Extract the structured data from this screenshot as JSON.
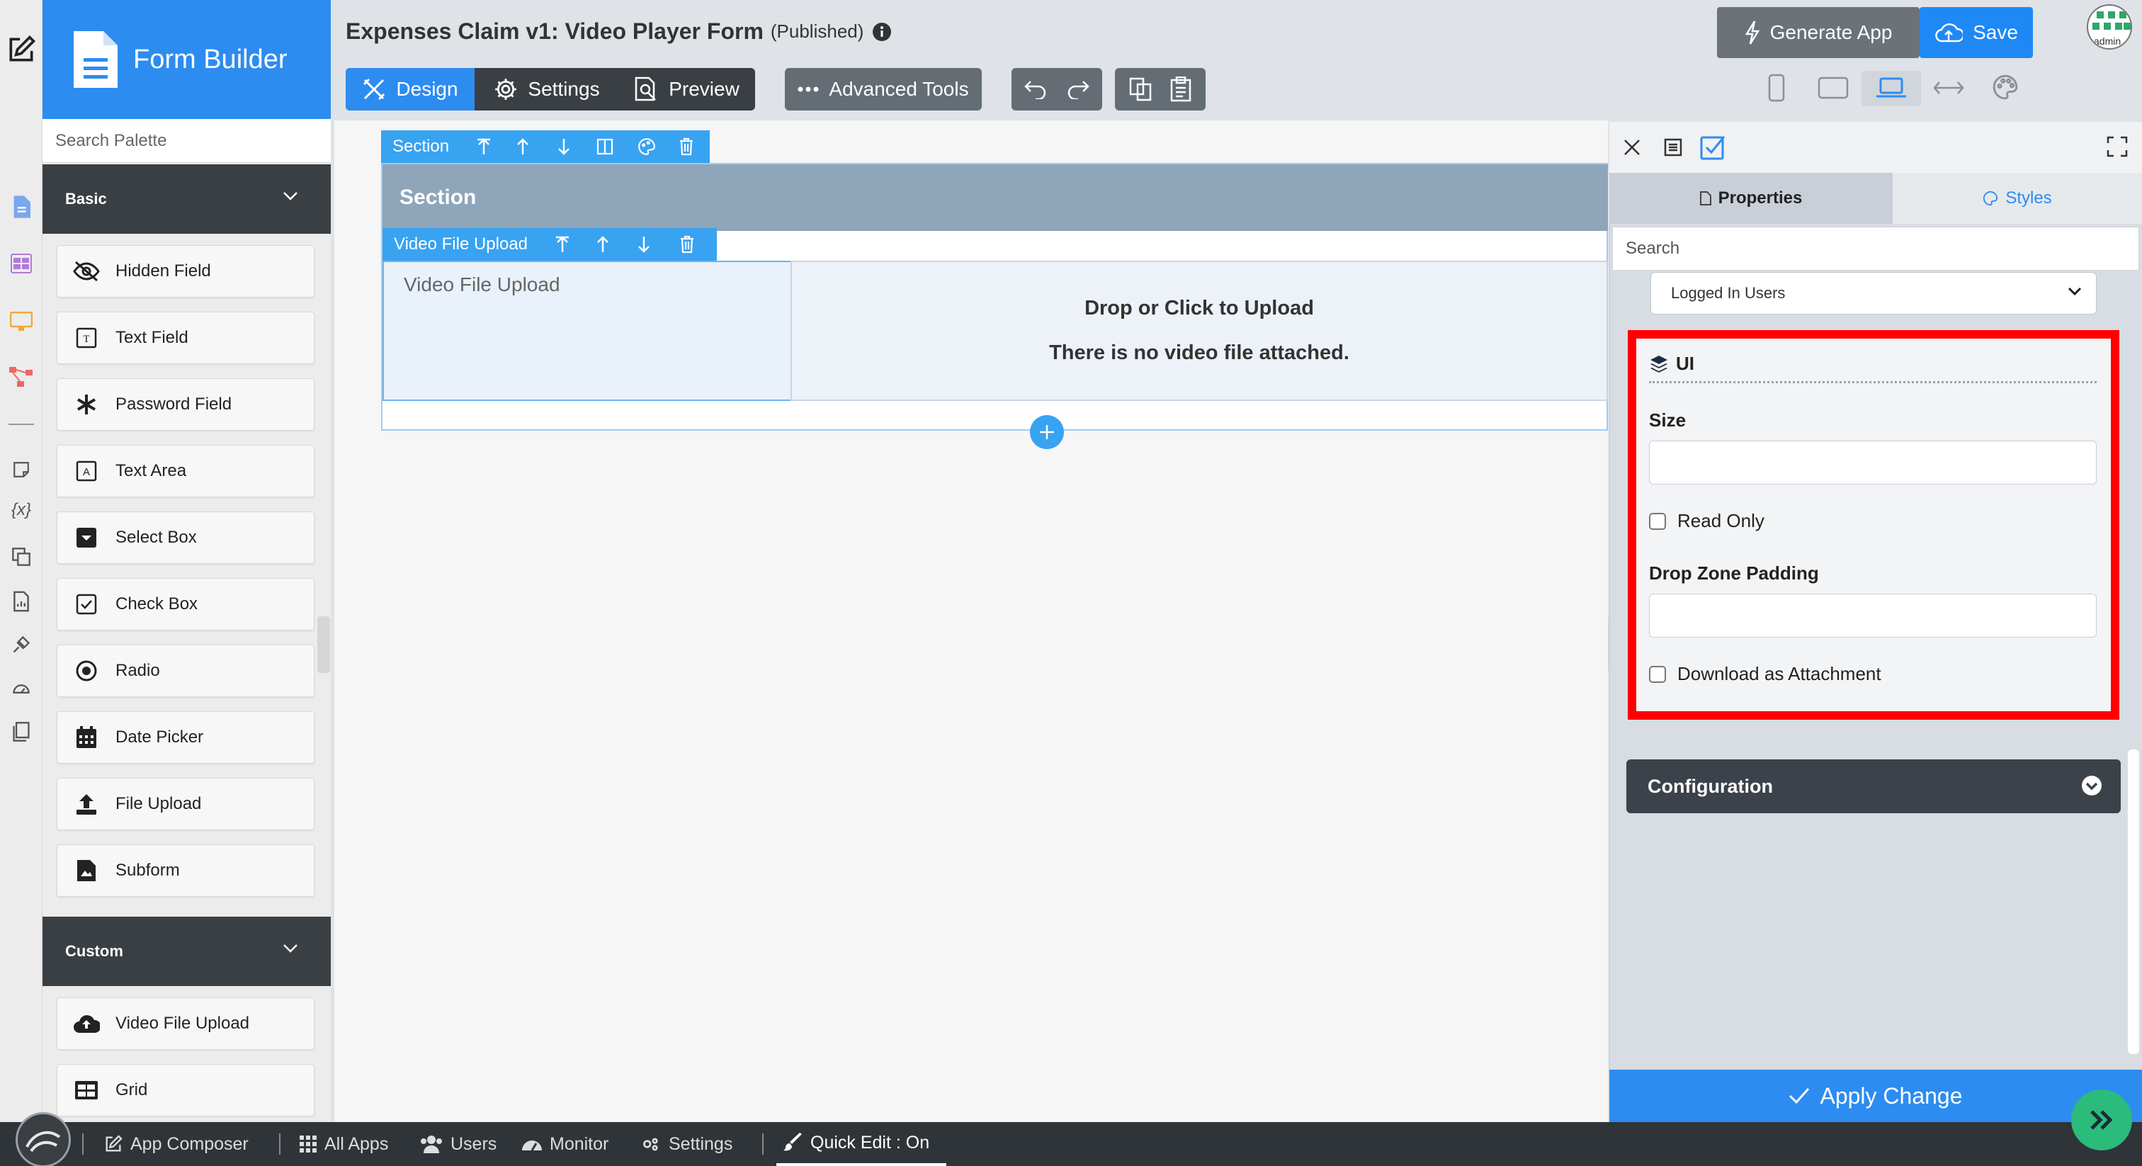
{
  "brand": {
    "title": "Form Builder"
  },
  "form": {
    "title": "Expenses Claim v1: Video Player Form",
    "status": "(Published)"
  },
  "toolbar": {
    "design": "Design",
    "settings": "Settings",
    "preview": "Preview",
    "advanced_tools": "Advanced Tools",
    "generate_app": "Generate App",
    "save": "Save",
    "avatar_label": "admin"
  },
  "palette": {
    "search_placeholder": "Search Palette",
    "basic": {
      "label": "Basic",
      "items": [
        {
          "label": "Hidden Field",
          "icon": "eye-slash-icon"
        },
        {
          "label": "Text Field",
          "icon": "text-field-icon"
        },
        {
          "label": "Password Field",
          "icon": "asterisk-icon"
        },
        {
          "label": "Text Area",
          "icon": "text-area-icon"
        },
        {
          "label": "Select Box",
          "icon": "select-box-icon"
        },
        {
          "label": "Check Box",
          "icon": "check-box-icon"
        },
        {
          "label": "Radio",
          "icon": "radio-icon"
        },
        {
          "label": "Date Picker",
          "icon": "calendar-icon"
        },
        {
          "label": "File Upload",
          "icon": "upload-icon"
        },
        {
          "label": "Subform",
          "icon": "subform-icon"
        }
      ]
    },
    "custom": {
      "label": "Custom",
      "items": [
        {
          "label": "Video File Upload",
          "icon": "cloud-upload-icon"
        },
        {
          "label": "Grid",
          "icon": "grid-icon"
        }
      ]
    }
  },
  "canvas": {
    "section_bar_label": "Section",
    "section_title": "Section",
    "field_bar_label": "Video File Upload",
    "field_label": "Video File Upload",
    "dropzone_line1": "Drop or Click to Upload",
    "dropzone_line2": "There is no video file attached."
  },
  "panel": {
    "tab_properties": "Properties",
    "tab_styles": "Styles",
    "search_placeholder": "Search",
    "permission_value": "Logged In Users",
    "ui": {
      "header": "UI",
      "size_label": "Size",
      "size_value": "",
      "read_only_label": "Read Only",
      "padding_label": "Drop Zone Padding",
      "padding_value": "",
      "download_label": "Download as Attachment"
    },
    "configuration": "Configuration",
    "apply": "Apply Change"
  },
  "bottom": {
    "app_composer": "App Composer",
    "all_apps": "All Apps",
    "users": "Users",
    "monitor": "Monitor",
    "settings": "Settings",
    "quick_edit": "Quick Edit : On"
  },
  "colors": {
    "primary": "#2d8cf0",
    "canvas_bar": "#38a3f1",
    "dark": "#3a3f44",
    "highlight": "#ff0000"
  }
}
